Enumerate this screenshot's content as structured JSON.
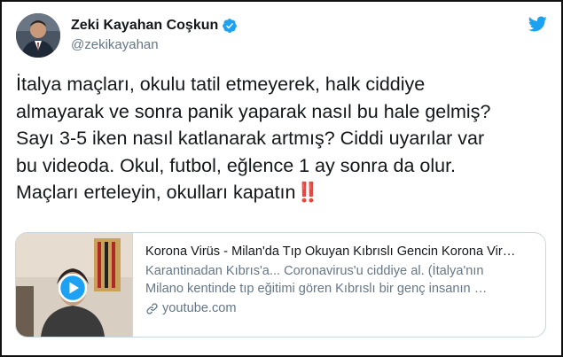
{
  "user": {
    "name": "Zeki Kayahan Coşkun",
    "handle": "@zekikayahan"
  },
  "tweet": {
    "lines": [
      "İtalya maçları, okulu tatil etmeyerek, halk ciddiye",
      "almayarak ve sonra panik yaparak nasıl bu hale gelmiş?",
      "Sayı 3-5 iken nasıl katlanarak artmış? Ciddi uyarılar var",
      "bu videoda. Okul, futbol, eğlence 1 ay sonra da olur.",
      "Maçları erteleyin, okulları kapatın"
    ],
    "emoji": "‼️"
  },
  "card": {
    "title": "Korona Virüs - Milan'da Tıp Okuyan Kıbrıslı Gencin Korona Vir…",
    "desc_line1": "Karantinadan Kıbrıs'a... Coronavirus'u ciddiye al. (İtalya'nın",
    "desc_line2": "Milano kentinde tıp eğitimi gören Kıbrıslı bir genç insanın …",
    "domain": "youtube.com"
  },
  "colors": {
    "brand": "#1da1f2",
    "text": "#14171a",
    "secondary": "#657786",
    "border": "#ccd6dd"
  },
  "icons": [
    "verified-badge-icon",
    "twitter-bird-icon",
    "play-icon",
    "link-icon"
  ]
}
